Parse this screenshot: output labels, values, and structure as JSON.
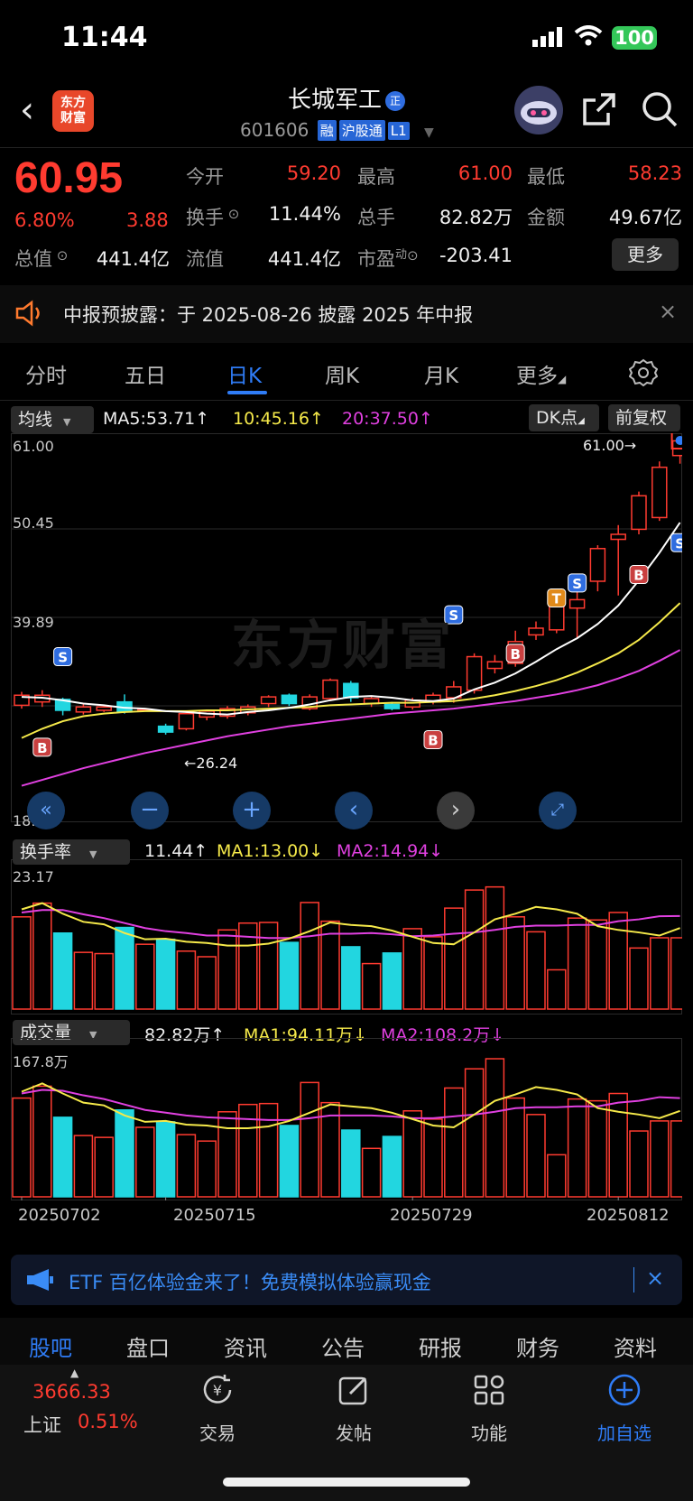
{
  "status": {
    "time": "11:44",
    "battery": "100"
  },
  "header": {
    "logo_text": "东方\n财富",
    "title": "长城军工",
    "title_badge": "正",
    "code": "601606",
    "tags": [
      "融",
      "沪股通",
      "L1"
    ]
  },
  "quote": {
    "price": "60.95",
    "change_pct": "6.80%",
    "change": "3.88",
    "stats": [
      {
        "label": "今开",
        "value": "59.20",
        "color": "red"
      },
      {
        "label": "最高",
        "value": "61.00",
        "color": "red"
      },
      {
        "label": "最低",
        "value": "58.23",
        "color": "red"
      },
      {
        "label": "换手",
        "value": "11.44%",
        "color": "white"
      },
      {
        "label": "总手",
        "value": "82.82万",
        "color": "white"
      },
      {
        "label": "金额",
        "value": "49.67亿",
        "color": "white"
      },
      {
        "label": "总值",
        "value": "441.4亿",
        "color": "white"
      },
      {
        "label": "流值",
        "value": "441.4亿",
        "color": "white"
      },
      {
        "label": "市盈",
        "value": "-203.41",
        "color": "white"
      }
    ],
    "pe_sup": "动",
    "more_label": "更多"
  },
  "notice": {
    "text": "中报预披露：于 2025-08-26 披露 2025 年中报"
  },
  "tabs": [
    "分时",
    "五日",
    "日K",
    "周K",
    "月K",
    "更多"
  ],
  "ma_bar": {
    "selector": "均线",
    "ma5": "MA5:53.71↑",
    "ma10": "10:45.16↑",
    "ma20": "20:37.50↑",
    "dk": "DK点",
    "adj": "前复权"
  },
  "kline": {
    "y_labels": [
      "61.00",
      "50.45",
      "39.89",
      "18.78"
    ],
    "max_label": "61.00→",
    "min_label": "←26.24",
    "watermark": "东方财富",
    "signals": [
      "S",
      "S",
      "S",
      "S",
      "B",
      "B",
      "B",
      "B",
      "T"
    ]
  },
  "turnover": {
    "selector": "换手率",
    "current": "11.44↑",
    "ma1": "MA1:13.00↓",
    "ma2": "MA2:14.94↓",
    "y_max": "23.17"
  },
  "volume": {
    "selector": "成交量",
    "current": "82.82万↑",
    "ma1": "MA1:94.11万↓",
    "ma2": "MA2:108.2万↓",
    "y_max": "167.8万"
  },
  "dates": [
    "20250702",
    "20250715",
    "20250729",
    "20250812"
  ],
  "ad": {
    "text": "ETF 百亿体验金来了！免费模拟体验赢现金"
  },
  "bottom_tabs": [
    "股吧",
    "盘口",
    "资讯",
    "公告",
    "研报",
    "财务",
    "资料"
  ],
  "index": {
    "value": "3666.33",
    "name": "上证",
    "pct": "0.51%"
  },
  "toolbar": [
    "交易",
    "发帖",
    "功能",
    "加自选"
  ],
  "colors": {
    "up": "#ff3b30",
    "down": "#22d6e0",
    "ma5": "#ffffff",
    "ma10": "#f5e94a",
    "ma20": "#e040e0",
    "accent": "#2f7cf6"
  },
  "chart_data": {
    "type": "candlestick",
    "ylim": [
      18.78,
      61.0
    ],
    "candles": [
      {
        "o": 29.4,
        "c": 30.6,
        "h": 31.0,
        "l": 29.0
      },
      {
        "o": 29.8,
        "c": 30.6,
        "h": 31.2,
        "l": 29.2
      },
      {
        "o": 30.1,
        "c": 28.8,
        "h": 30.3,
        "l": 28.2
      },
      {
        "o": 28.6,
        "c": 29.2,
        "h": 29.5,
        "l": 28.3
      },
      {
        "o": 28.8,
        "c": 29.2,
        "h": 29.4,
        "l": 28.6
      },
      {
        "o": 29.8,
        "c": 28.6,
        "h": 30.7,
        "l": 28.4
      },
      {
        "o": 28.8,
        "c": 28.9,
        "h": 29.0,
        "l": 28.7
      },
      {
        "o": 26.9,
        "c": 26.2,
        "h": 27.2,
        "l": 25.9
      },
      {
        "o": 26.6,
        "c": 28.4,
        "h": 28.6,
        "l": 26.4
      },
      {
        "o": 28.0,
        "c": 28.7,
        "h": 28.9,
        "l": 27.6
      },
      {
        "o": 28.1,
        "c": 29.0,
        "h": 29.3,
        "l": 27.8
      },
      {
        "o": 28.5,
        "c": 29.2,
        "h": 29.5,
        "l": 28.2
      },
      {
        "o": 29.6,
        "c": 30.4,
        "h": 30.6,
        "l": 29.2
      },
      {
        "o": 30.6,
        "c": 29.6,
        "h": 30.8,
        "l": 29.3
      },
      {
        "o": 29.0,
        "c": 30.4,
        "h": 30.7,
        "l": 28.8
      },
      {
        "o": 30.2,
        "c": 32.4,
        "h": 32.6,
        "l": 29.9
      },
      {
        "o": 32.0,
        "c": 30.3,
        "h": 32.3,
        "l": 29.8
      },
      {
        "o": 29.6,
        "c": 30.2,
        "h": 30.5,
        "l": 29.2
      },
      {
        "o": 29.5,
        "c": 29.0,
        "h": 29.8,
        "l": 28.8
      },
      {
        "o": 29.2,
        "c": 30.0,
        "h": 30.3,
        "l": 28.9
      },
      {
        "o": 29.8,
        "c": 30.6,
        "h": 30.9,
        "l": 29.5
      },
      {
        "o": 30.3,
        "c": 31.6,
        "h": 32.3,
        "l": 29.7
      },
      {
        "o": 31.2,
        "c": 35.2,
        "h": 35.6,
        "l": 30.8
      },
      {
        "o": 33.8,
        "c": 34.6,
        "h": 35.4,
        "l": 33.2
      },
      {
        "o": 34.4,
        "c": 37.0,
        "h": 38.3,
        "l": 34.0
      },
      {
        "o": 37.8,
        "c": 38.6,
        "h": 39.4,
        "l": 37.2
      },
      {
        "o": 38.4,
        "c": 41.2,
        "h": 41.6,
        "l": 38.0
      },
      {
        "o": 41.0,
        "c": 42.0,
        "h": 43.2,
        "l": 37.4
      },
      {
        "o": 44.2,
        "c": 48.1,
        "h": 48.5,
        "l": 43.0
      },
      {
        "o": 49.2,
        "c": 49.8,
        "h": 50.9,
        "l": 42.5
      },
      {
        "o": 50.4,
        "c": 54.4,
        "h": 54.9,
        "l": 49.8
      },
      {
        "o": 51.8,
        "c": 57.8,
        "h": 58.5,
        "l": 51.4
      },
      {
        "o": 59.2,
        "c": 60.95,
        "h": 61.0,
        "l": 58.23
      }
    ],
    "ma5": [
      30.4,
      30.3,
      30.0,
      29.6,
      29.4,
      29.1,
      29.0,
      28.7,
      28.6,
      28.4,
      28.3,
      28.6,
      28.8,
      29.1,
      29.5,
      30.0,
      30.4,
      30.5,
      30.3,
      30.0,
      29.9,
      30.2,
      31.3,
      32.1,
      33.2,
      34.6,
      36.1,
      37.4,
      39.1,
      41.3,
      44.3,
      47.6,
      51.2
    ],
    "ma10": [
      25.5,
      26.6,
      27.5,
      28.1,
      28.4,
      28.6,
      28.7,
      28.7,
      28.7,
      28.8,
      28.8,
      28.9,
      29.0,
      29.1,
      29.2,
      29.4,
      29.5,
      29.6,
      29.7,
      29.7,
      29.8,
      29.9,
      30.2,
      30.6,
      31.1,
      31.7,
      32.4,
      33.3,
      34.4,
      35.6,
      37.2,
      39.3,
      41.6
    ],
    "ma20": [
      19.8,
      20.5,
      21.2,
      21.9,
      22.5,
      23.1,
      23.7,
      24.2,
      24.7,
      25.2,
      25.7,
      26.1,
      26.5,
      26.9,
      27.2,
      27.5,
      27.8,
      28.1,
      28.4,
      28.6,
      28.8,
      29.0,
      29.3,
      29.6,
      29.9,
      30.3,
      30.7,
      31.2,
      31.8,
      32.6,
      33.5,
      34.7,
      36.0
    ],
    "turnover": [
      14.8,
      17.0,
      12.2,
      9.1,
      8.9,
      13.1,
      10.4,
      11.2,
      9.3,
      8.4,
      12.7,
      13.8,
      13.9,
      10.7,
      17.1,
      14.1,
      10.0,
      7.3,
      9.0,
      12.9,
      11.6,
      16.2,
      19.1,
      19.6,
      14.8,
      12.4,
      6.3,
      14.6,
      14.3,
      15.5,
      9.8,
      11.44,
      11.44
    ],
    "turnover_ma1": [
      16.0,
      17.0,
      15.3,
      14.0,
      13.6,
      12.2,
      11.2,
      11.3,
      10.8,
      10.6,
      10.2,
      10.2,
      10.5,
      11.3,
      12.5,
      13.9,
      13.5,
      13.3,
      12.6,
      11.6,
      10.6,
      10.4,
      12.3,
      14.4,
      15.3,
      16.4,
      16.0,
      15.3,
      13.3,
      12.7,
      12.3,
      11.8,
      13.0
    ],
    "turnover_ma2": [
      15.5,
      15.9,
      15.9,
      15.2,
      14.6,
      13.8,
      13.0,
      12.5,
      12.2,
      11.8,
      11.8,
      11.6,
      11.4,
      11.4,
      11.7,
      12.1,
      12.1,
      12.2,
      12.0,
      11.7,
      11.8,
      12.1,
      12.3,
      12.7,
      13.2,
      13.4,
      13.4,
      13.5,
      13.5,
      14.1,
      14.4,
      14.9,
      14.94
    ],
    "volume": [
      108,
      121,
      87,
      67,
      65,
      95,
      76,
      82,
      68,
      61,
      93,
      101,
      102,
      78,
      125,
      103,
      73,
      53,
      66,
      94,
      85,
      119,
      140,
      151,
      108,
      90,
      46,
      107,
      105,
      113,
      72,
      83,
      83
    ],
    "volume_ma1": [
      115,
      124,
      113,
      103,
      100,
      89,
      82,
      83,
      79,
      78,
      75,
      75,
      77,
      83,
      92,
      101,
      99,
      97,
      92,
      85,
      78,
      76,
      90,
      105,
      112,
      120,
      117,
      112,
      97,
      93,
      90,
      86,
      94
    ],
    "volume_ma2": [
      113,
      117,
      116,
      111,
      107,
      101,
      95,
      92,
      89,
      87,
      86,
      85,
      84,
      84,
      86,
      89,
      89,
      89,
      88,
      86,
      86,
      88,
      90,
      93,
      97,
      98,
      98,
      99,
      99,
      103,
      105,
      109,
      108
    ]
  }
}
